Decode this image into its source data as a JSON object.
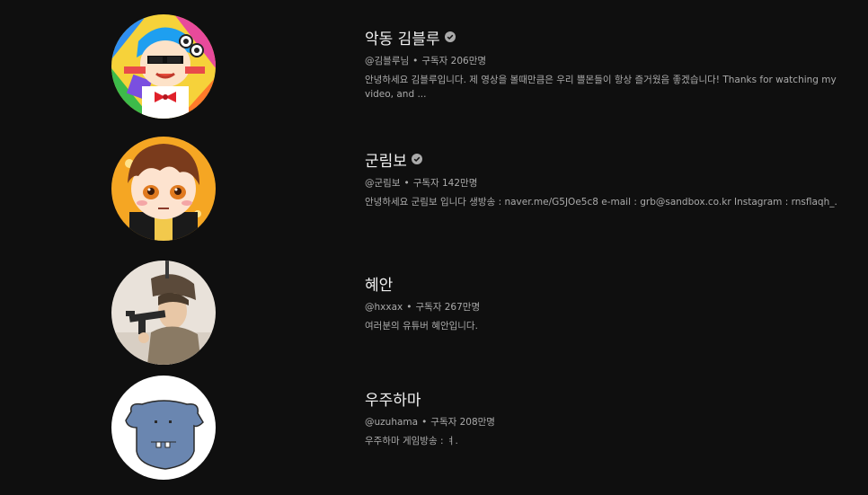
{
  "channels": [
    {
      "name": "악동 김블루",
      "verified": true,
      "handle": "@김블루님",
      "subscribers": "구독자 206만명",
      "description": "안녕하세요 김블루입니다. 제 영상을 볼때만큼은 우리 쁠몬들이 항상 즐거웠음 좋겠습니다! Thanks for watching my video, and ..."
    },
    {
      "name": "군림보",
      "verified": true,
      "handle": "@군림보",
      "subscribers": "구독자 142만명",
      "description": "안녕하세요 군림보 입니다 생방송 : naver.me/G5JOe5c8 e-mail : grb@sandbox.co.kr Instagram : rnsflaqh_."
    },
    {
      "name": "혜안",
      "verified": false,
      "handle": "@hxxax",
      "subscribers": "구독자 267만명",
      "description": "여러분의 유튜버 혜안입니다."
    },
    {
      "name": "우주하마",
      "verified": false,
      "handle": "@uzuhama",
      "subscribers": "구독자 208만명",
      "description": "우주하마 게임방송 : ㅕ."
    }
  ],
  "separator": "•",
  "colors": {
    "background": "#0f0f0f",
    "title": "#f1f1f1",
    "secondary": "#aaaaaa"
  }
}
